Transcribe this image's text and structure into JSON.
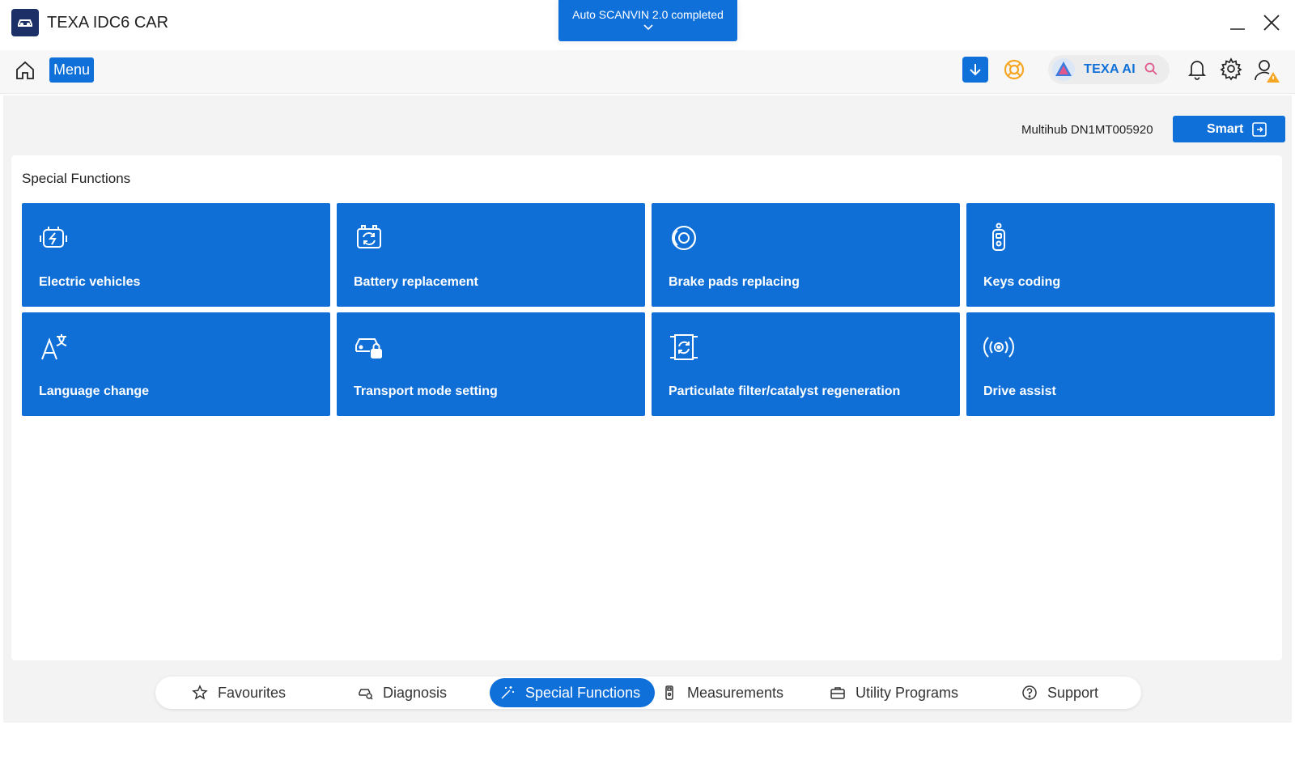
{
  "app": {
    "title": "TEXA IDC6 CAR"
  },
  "banner": {
    "text": "Auto SCANVIN 2.0 completed"
  },
  "toolbar": {
    "menu_label": "Menu",
    "ai_label": "TEXA AI"
  },
  "device": {
    "label": "Multihub DN1MT005920",
    "smart_label": "Smart"
  },
  "section": {
    "title": "Special Functions"
  },
  "tiles": [
    {
      "label": "Electric vehicles",
      "icon": "electric-vehicle-icon"
    },
    {
      "label": "Battery replacement",
      "icon": "battery-icon"
    },
    {
      "label": "Brake pads replacing",
      "icon": "brake-pad-icon"
    },
    {
      "label": "Keys coding",
      "icon": "car-key-icon"
    },
    {
      "label": "Language change",
      "icon": "language-icon"
    },
    {
      "label": "Transport mode setting",
      "icon": "transport-mode-icon"
    },
    {
      "label": "Particulate filter/catalyst regeneration",
      "icon": "filter-regeneration-icon"
    },
    {
      "label": "Drive assist",
      "icon": "drive-assist-icon"
    }
  ],
  "bottom_nav": [
    {
      "label": "Favourites",
      "icon": "star-icon",
      "active": false
    },
    {
      "label": "Diagnosis",
      "icon": "car-diagnosis-icon",
      "active": false
    },
    {
      "label": "Special Functions",
      "icon": "magic-wand-icon",
      "active": true
    },
    {
      "label": "Measurements",
      "icon": "multimeter-icon",
      "active": false
    },
    {
      "label": "Utility Programs",
      "icon": "toolbox-icon",
      "active": false
    },
    {
      "label": "Support",
      "icon": "help-icon",
      "active": false
    }
  ],
  "colors": {
    "accent": "#1070d9",
    "tile": "#0f6fd6",
    "title_logo": "#1c2f66",
    "lifebuoy": "#f5a623",
    "warning": "#f5a623"
  }
}
